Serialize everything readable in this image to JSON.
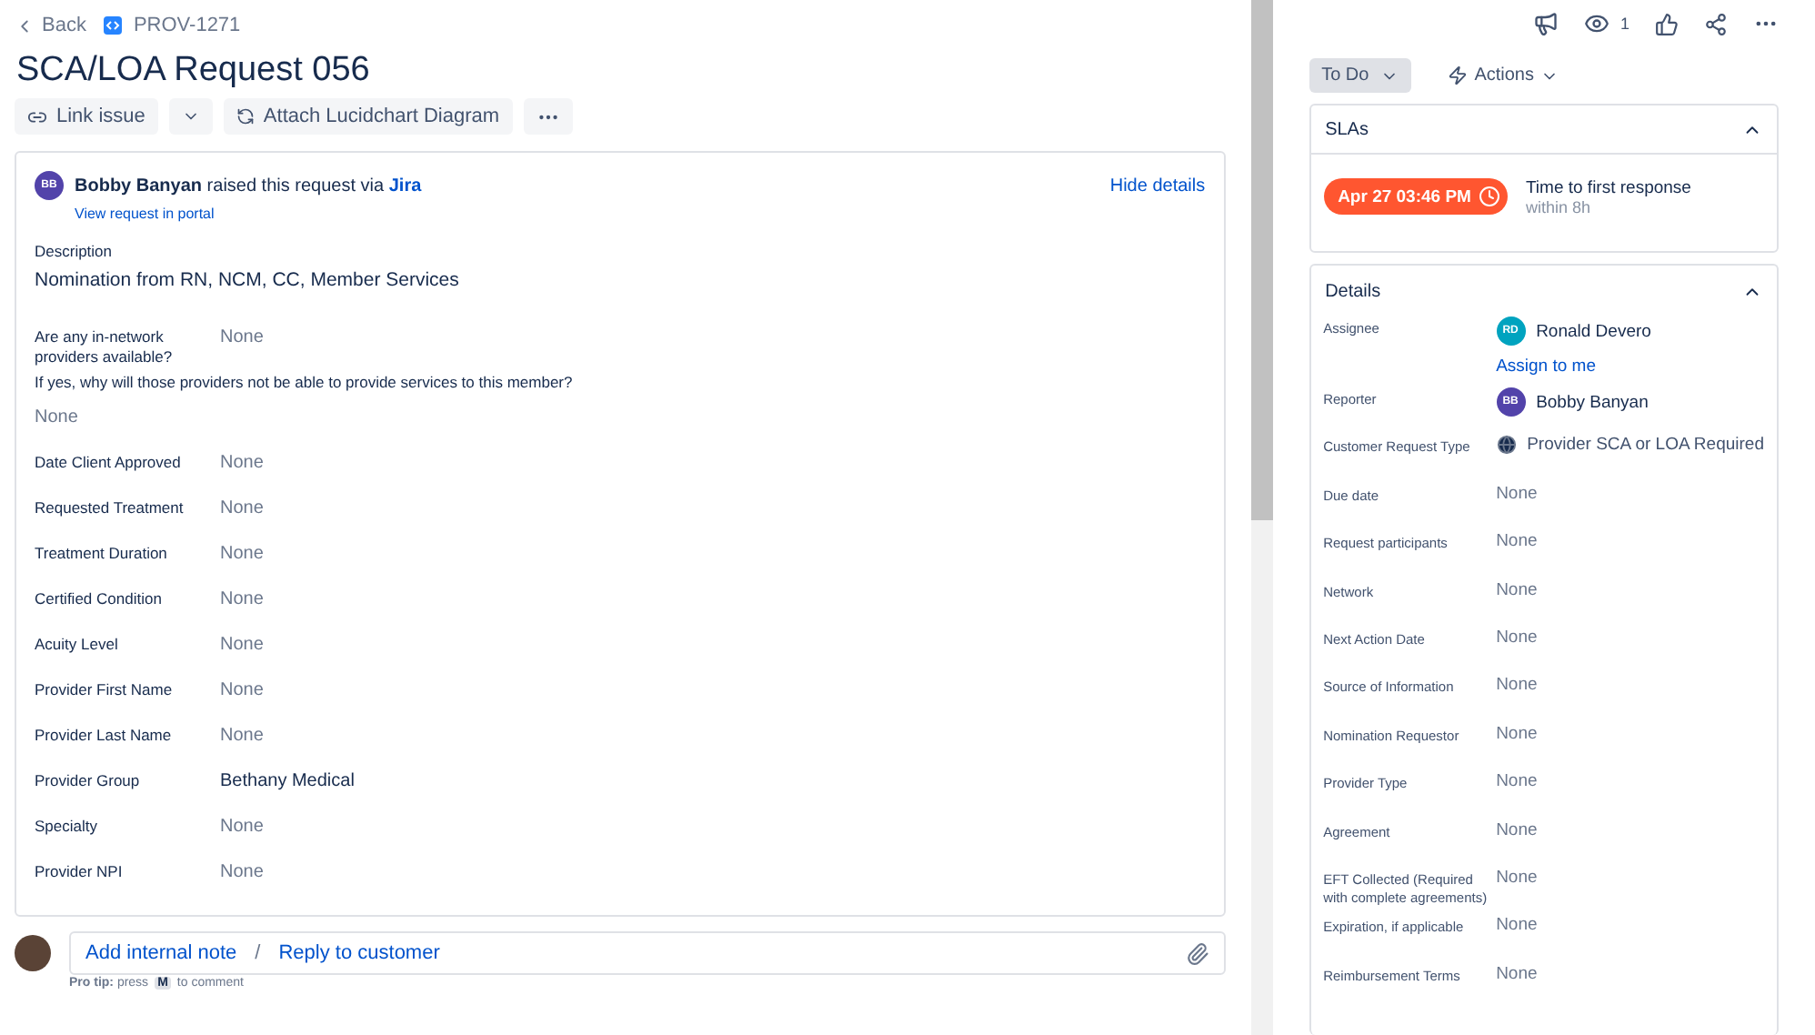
{
  "breadcrumbs": {
    "back": "Back",
    "issue_key": "PROV-1271"
  },
  "title": "SCA/LOA Request 056",
  "toolbar": {
    "link_issue": "Link issue",
    "attach": "Attach Lucidchart Diagram"
  },
  "request": {
    "reporter": "Bobby Banyan",
    "initials": "BB",
    "color": "#5243aa",
    "raised_text": "raised this request via",
    "channel": "Jira",
    "portal_link": "View request in portal",
    "hide_details": "Hide details"
  },
  "description": {
    "label": "Description",
    "text": "Nomination from RN, NCM, CC, Member Services"
  },
  "fields": [
    {
      "kind": "inline",
      "label": "Are any in-network providers available?",
      "value": "None"
    },
    {
      "kind": "stacked",
      "label": "If yes, why will those providers not be able to provide services to this member?",
      "value": "None"
    },
    {
      "kind": "inline",
      "label": "Date Client Approved",
      "value": "None"
    },
    {
      "kind": "inline",
      "label": "Requested Treatment",
      "value": "None"
    },
    {
      "kind": "inline",
      "label": "Treatment Duration",
      "value": "None"
    },
    {
      "kind": "inline",
      "label": "Certified Condition",
      "value": "None"
    },
    {
      "kind": "inline",
      "label": "Acuity Level",
      "value": "None"
    },
    {
      "kind": "inline",
      "label": "Provider First Name",
      "value": "None"
    },
    {
      "kind": "inline",
      "label": "Provider Last Name",
      "value": "None"
    },
    {
      "kind": "inline",
      "label": "Provider Group",
      "value": "Bethany Medical"
    },
    {
      "kind": "inline",
      "label": "Specialty",
      "value": "None"
    },
    {
      "kind": "inline",
      "label": "Provider NPI",
      "value": "None"
    }
  ],
  "comment": {
    "internal_note": "Add internal note",
    "separator": "/",
    "reply": "Reply to customer",
    "tip": "**Pro tip:** press",
    "tip_key": "M",
    "tip_suffix": "to comment"
  },
  "header": {
    "watchers": "1"
  },
  "status": "To Do",
  "actions": "Actions",
  "slas": {
    "title": "SLAs",
    "expanded": true,
    "items": [
      {
        "time": "Apr 27 03:46 PM",
        "name": "Time to first response",
        "goal": "within 8h"
      }
    ]
  },
  "details": {
    "title": "Details",
    "expanded": true,
    "fields": [
      {
        "kind": "user",
        "label": "Assignee",
        "value": "Ronald Devero",
        "initials": "RD",
        "color": "#00a3bf",
        "action": "Assign to me"
      },
      {
        "kind": "user",
        "label": "Reporter",
        "value": "Bobby Banyan",
        "initials": "BB",
        "color": "#5243aa"
      },
      {
        "kind": "request_type",
        "label": "Customer Request Type",
        "value": "Provider SCA or LOA Required"
      },
      {
        "kind": "empty",
        "label": "Due date",
        "value": "None"
      },
      {
        "kind": "empty",
        "label": "Request participants",
        "value": "None"
      },
      {
        "kind": "empty",
        "label": "Network",
        "value": "None"
      },
      {
        "kind": "empty",
        "label": "Next Action Date",
        "value": "None"
      },
      {
        "kind": "empty",
        "label": "Source of Information",
        "value": "None"
      },
      {
        "kind": "empty",
        "label": "Nomination Requestor",
        "value": "None"
      },
      {
        "kind": "empty",
        "label": "Provider Type",
        "value": "None"
      },
      {
        "kind": "empty",
        "label": "Agreement",
        "value": "None"
      },
      {
        "kind": "empty",
        "label": "EFT Collected (Required with complete agreements)",
        "value": "None"
      },
      {
        "kind": "empty",
        "label": "Expiration, if applicable",
        "value": "None"
      },
      {
        "kind": "empty",
        "label": "Reimbursement Terms",
        "value": "None"
      }
    ]
  }
}
